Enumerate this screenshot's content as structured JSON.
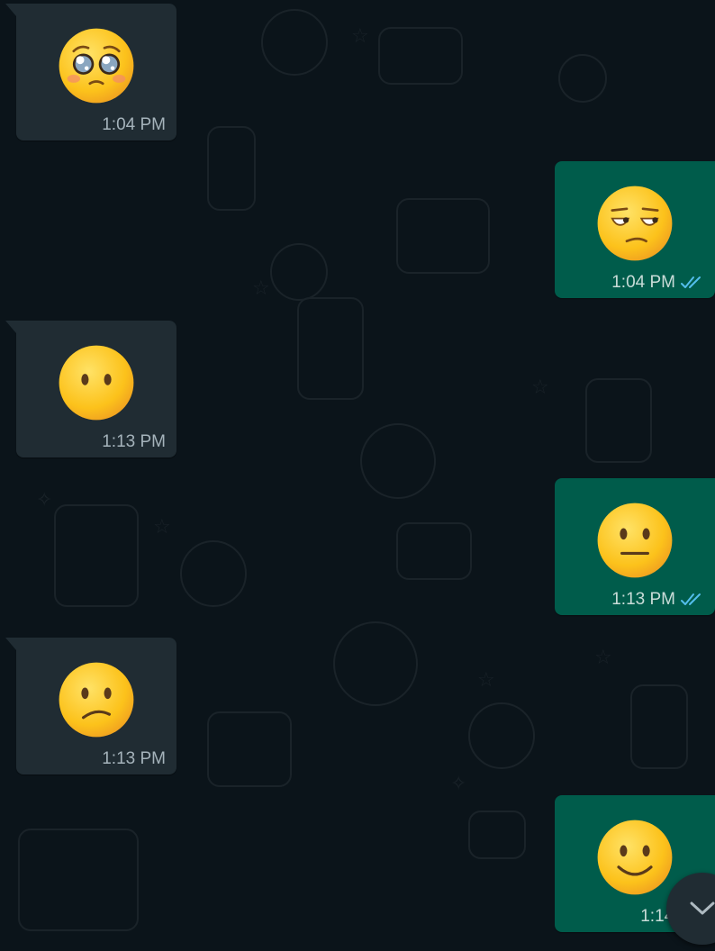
{
  "colors": {
    "background": "#0b141a",
    "incoming_bubble": "#202c33",
    "outgoing_bubble": "#005c4b",
    "read_ticks": "#53bdeb",
    "timestamp": "#a5b3bb"
  },
  "messages": [
    {
      "direction": "incoming",
      "emoji": "pleading-face",
      "time": "1:04 PM"
    },
    {
      "direction": "outgoing",
      "emoji": "unamused-face",
      "time": "1:04 PM",
      "status": "read"
    },
    {
      "direction": "incoming",
      "emoji": "face-without-mouth",
      "time": "1:13 PM"
    },
    {
      "direction": "outgoing",
      "emoji": "neutral-face",
      "time": "1:13 PM",
      "status": "read"
    },
    {
      "direction": "incoming",
      "emoji": "confused-face",
      "time": "1:13 PM"
    },
    {
      "direction": "outgoing",
      "emoji": "slightly-smiling-face",
      "time": "1:14 PM"
    }
  ],
  "scroll_button": {
    "icon": "chevron-down-icon"
  }
}
